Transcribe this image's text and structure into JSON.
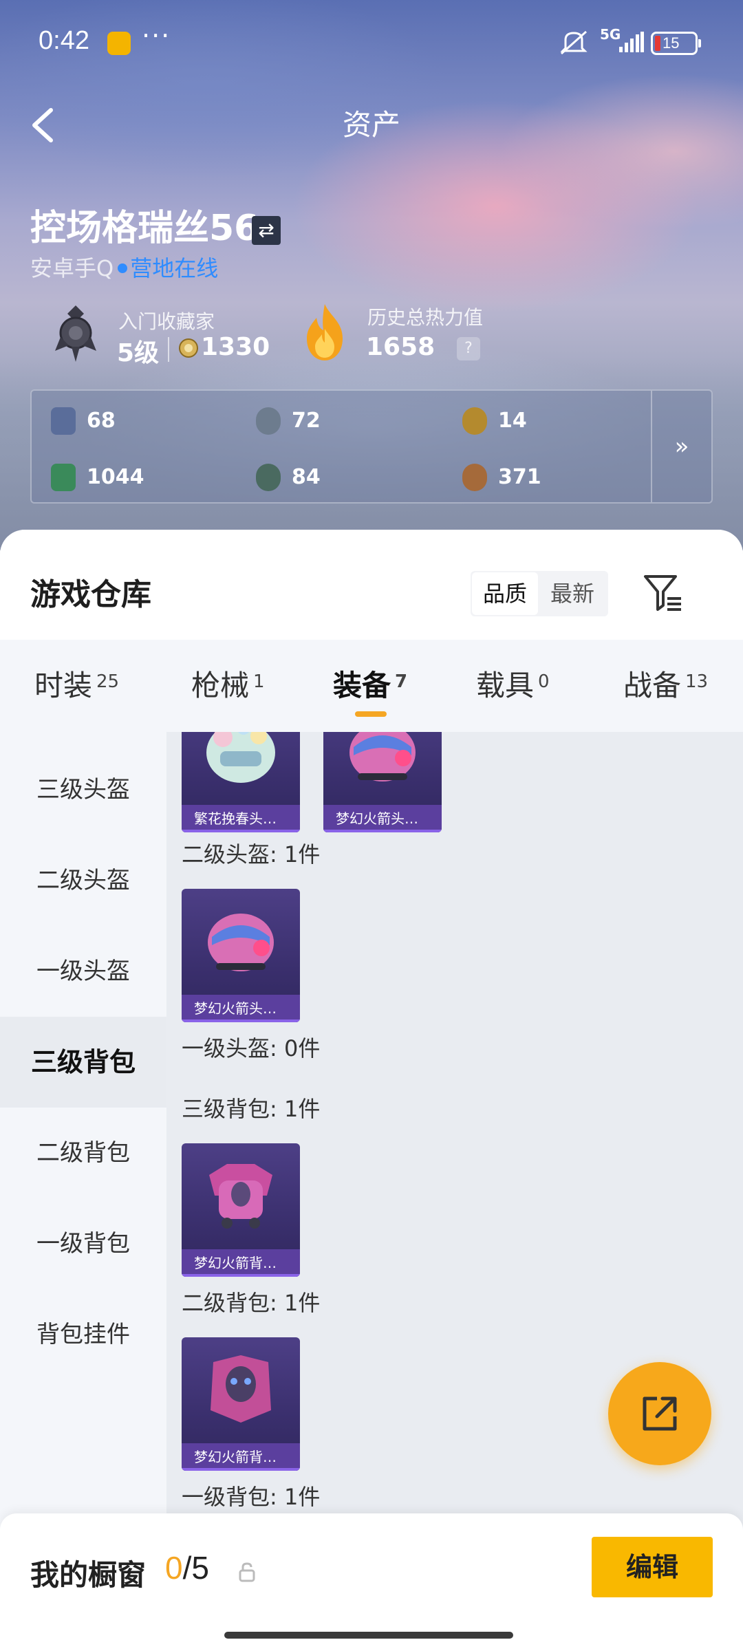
{
  "status_bar": {
    "time": "0:42",
    "network": "5G",
    "battery": "15"
  },
  "header": {
    "title": "资产"
  },
  "profile": {
    "name": "控场格瑞丝56",
    "account": "安卓手Q",
    "online_status": "营地在线",
    "collector_title": "入门收藏家",
    "collector_level": "5级",
    "collector_points": "1330",
    "heat_title": "历史总热力值",
    "heat_value": "1658",
    "help_symbol": "?"
  },
  "stats": [
    {
      "icon": "card-icon",
      "value": "68",
      "color": "#5a6d9a"
    },
    {
      "icon": "silver-emblem-icon",
      "value": "72",
      "color": "#6d7c8e"
    },
    {
      "icon": "gold-emblem-icon",
      "value": "14",
      "color": "#b48a2e"
    },
    {
      "icon": "green-card-icon",
      "value": "1044",
      "color": "#3a8a5a"
    },
    {
      "icon": "gear-orb-icon",
      "value": "84",
      "color": "#4a6a60"
    },
    {
      "icon": "bronze-emblem-icon",
      "value": "371",
      "color": "#a56a3a"
    }
  ],
  "stats_more_symbol": "»",
  "warehouse": {
    "title": "游戏仓库",
    "sort_options": [
      "品质",
      "最新"
    ],
    "tabs": [
      {
        "label": "时装",
        "count": "25"
      },
      {
        "label": "枪械",
        "count": "1"
      },
      {
        "label": "装备",
        "count": "7",
        "active": true
      },
      {
        "label": "载具",
        "count": "0"
      },
      {
        "label": "战备",
        "count": "13"
      }
    ],
    "side_nav": [
      "三级头盔",
      "二级头盔",
      "一级头盔",
      "三级背包",
      "二级背包",
      "一级背包",
      "背包挂件"
    ],
    "active_side": "三级背包",
    "sections": [
      {
        "label": "",
        "items": [
          "繁花挽春头…",
          "梦幻火箭头…"
        ]
      },
      {
        "label": "二级头盔: 1件",
        "items": [
          "梦幻火箭头…"
        ]
      },
      {
        "label": "一级头盔: 0件",
        "items": []
      },
      {
        "label": "三级背包: 1件",
        "items": [
          "梦幻火箭背…"
        ]
      },
      {
        "label": "二级背包: 1件",
        "items": [
          "梦幻火箭背…"
        ]
      },
      {
        "label": "一级背包: 1件",
        "items": []
      }
    ]
  },
  "showcase": {
    "title": "我的橱窗",
    "current": "0",
    "total": "/5",
    "edit_label": "编辑"
  },
  "colors": {
    "accent": "#f5a623",
    "online": "#2f8cff",
    "card_bg": "#3a2f6d",
    "card_label": "#5b3f9e"
  }
}
